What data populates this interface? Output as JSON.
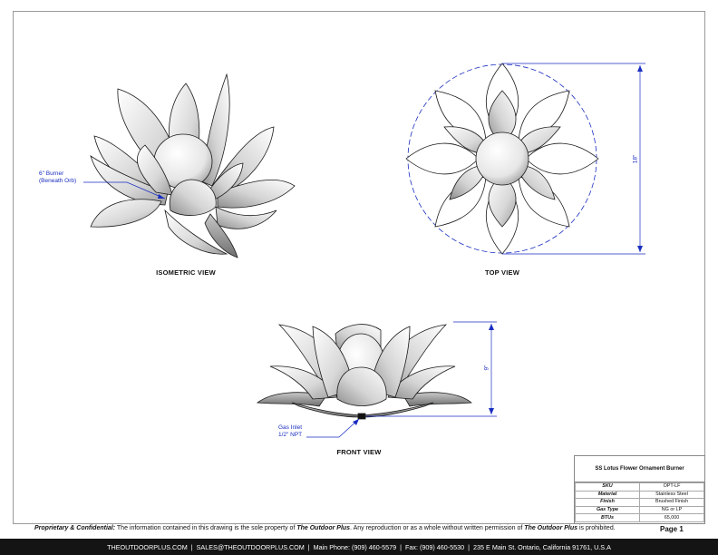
{
  "views": {
    "isometric": "ISOMETRIC VIEW",
    "top": "TOP VIEW",
    "front": "FRONT VIEW"
  },
  "callouts": {
    "burner_line1": "6\" Burner",
    "burner_line2": "(Beneath Orb)",
    "gas_line1": "Gas Inlet",
    "gas_line2": "1/2\" NPT"
  },
  "dimensions": {
    "width": "18\"",
    "height": "9\""
  },
  "title_block": {
    "title": "SS Lotus Flower Ornament Burner",
    "rows": [
      {
        "key": "SKU",
        "value": "OPT-LF"
      },
      {
        "key": "Material",
        "value": "Stainless Steel"
      },
      {
        "key": "Finish",
        "value": "Brushed Finish"
      },
      {
        "key": "Gas Type",
        "value": "NG or LP"
      },
      {
        "key": "BTUs",
        "value": "65,000"
      }
    ]
  },
  "notice": {
    "label": "Proprietary & Confidential:",
    "text1": " The information contained in this drawing is the sole property of ",
    "company1": "The Outdoor Plus",
    "text2": ". Any reproduction or as a whole without written permission of ",
    "company2": "The Outdoor Plus",
    "text3": " is prohibited."
  },
  "page": "Page 1",
  "footer": {
    "website": "THEOUTDOORPLUS.COM",
    "email": "SALES@THEOUTDOORPLUS.COM",
    "phone": "Main Phone: (909) 460-5579",
    "fax": "Fax: (909) 460-5530",
    "address": "235 E Main St. Ontario, California 91761, U.S.A"
  },
  "colors": {
    "dimension": "#1a2ec0",
    "footer_bg": "#141414"
  }
}
